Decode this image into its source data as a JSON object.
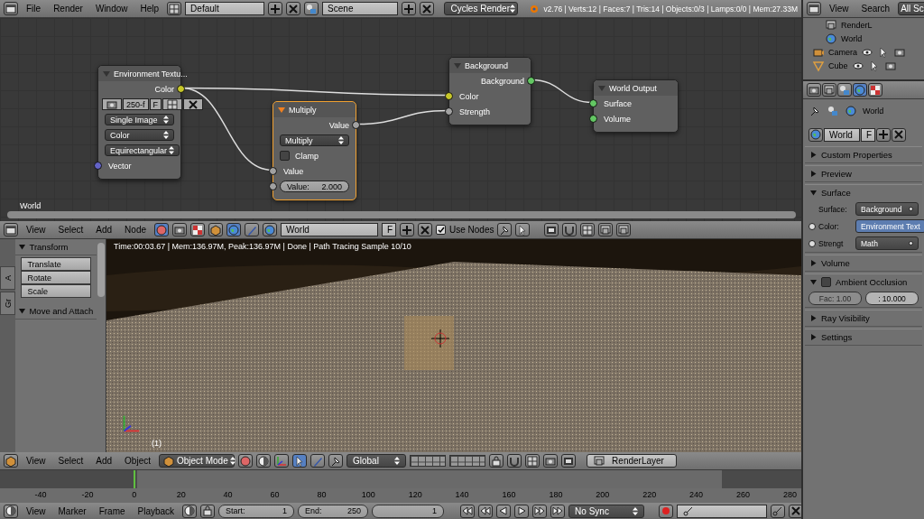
{
  "top_bar": {
    "menus": [
      "File",
      "Render",
      "Window",
      "Help"
    ],
    "layout": "Default",
    "scene": "Scene",
    "engine": "Cycles Render",
    "stats": "v2.76 | Verts:12 | Faces:7 | Tris:14 | Objects:0/3 | Lamps:0/0 | Mem:27.33M"
  },
  "node_editor": {
    "label": "World",
    "nodes": [
      {
        "title": "Environment Textu...",
        "selected": false,
        "rows": [
          {
            "kind": "output",
            "label": "Color",
            "color": "#c7c729"
          },
          {
            "kind": "image",
            "value": "250-f",
            "fake": "F"
          },
          {
            "kind": "dropdown",
            "value": "Single Image"
          },
          {
            "kind": "dropdown",
            "value": "Color"
          },
          {
            "kind": "dropdown",
            "value": "Equirectangular"
          },
          {
            "kind": "input",
            "label": "Vector",
            "color": "#6363c7"
          }
        ]
      },
      {
        "title": "Multiply",
        "selected": true,
        "rows": [
          {
            "kind": "output",
            "label": "Value",
            "color": "#a1a1a1"
          },
          {
            "kind": "dropdown",
            "value": "Multiply"
          },
          {
            "kind": "checkbox",
            "label": "Clamp",
            "checked": false
          },
          {
            "kind": "input",
            "label": "Value",
            "color": "#a1a1a1"
          },
          {
            "kind": "field",
            "label": "Value:",
            "value": "2.000",
            "color": "#a1a1a1"
          }
        ]
      },
      {
        "title": "Background",
        "selected": false,
        "rows": [
          {
            "kind": "output",
            "label": "Background",
            "color": "#63c763"
          },
          {
            "kind": "input",
            "label": "Color",
            "color": "#c7c729"
          },
          {
            "kind": "input",
            "label": "Strength",
            "color": "#a1a1a1"
          }
        ]
      },
      {
        "title": "World Output",
        "selected": false,
        "rows": [
          {
            "kind": "input",
            "label": "Surface",
            "color": "#63c763"
          },
          {
            "kind": "input",
            "label": "Volume",
            "color": "#63c763"
          }
        ]
      }
    ]
  },
  "node_header": {
    "menus": [
      "View",
      "Select",
      "Add",
      "Node"
    ],
    "world": "World",
    "fake": "F",
    "use_nodes": {
      "label": "Use Nodes",
      "checked": true
    }
  },
  "tool_shelf": {
    "tabs": [
      "A",
      "Gr"
    ],
    "panels": [
      {
        "title": "Transform",
        "expanded": true,
        "buttons": [
          "Translate",
          "Rotate",
          "Scale"
        ]
      },
      {
        "title": "Move and Attach",
        "expanded": true
      }
    ]
  },
  "viewport": {
    "render_info": "Time:00:03.67 | Mem:136.97M, Peak:136.97M | Done | Path Tracing Sample 10/10",
    "frame": "(1)"
  },
  "view3d_header": {
    "menus": [
      "View",
      "Select",
      "Add",
      "Object"
    ],
    "mode": "Object Mode",
    "orientation": "Global",
    "render_layer": "RenderLayer"
  },
  "timeline": {
    "ticks": [
      "-40",
      "-20",
      "0",
      "20",
      "40",
      "60",
      "80",
      "100",
      "120",
      "140",
      "160",
      "180",
      "200",
      "220",
      "240",
      "260",
      "280"
    ],
    "menus": [
      "View",
      "Marker",
      "Frame",
      "Playback"
    ],
    "start": {
      "label": "Start:",
      "value": "1"
    },
    "end": {
      "label": "End:",
      "value": "250"
    },
    "current": "1",
    "sync": "No Sync"
  },
  "outliner": {
    "menus": [
      "View",
      "Search"
    ],
    "filter": "All Sc",
    "items": [
      {
        "label": "RenderL",
        "kind": "layers"
      },
      {
        "label": "World",
        "kind": "world"
      },
      {
        "label": "Camera",
        "kind": "camera"
      },
      {
        "label": "Cube",
        "kind": "mesh"
      }
    ]
  },
  "properties": {
    "tabs": [
      {
        "kind": "render",
        "selected": false
      },
      {
        "kind": "layers",
        "selected": false
      },
      {
        "kind": "scene",
        "selected": false
      },
      {
        "kind": "world",
        "selected": true
      },
      {
        "kind": "texture",
        "selected": false
      }
    ],
    "breadcrumb": "World",
    "datablock": "World",
    "fake": "F",
    "panels": [
      {
        "title": "Custom Properties",
        "expanded": false
      },
      {
        "title": "Preview",
        "expanded": false
      },
      {
        "title": "Surface",
        "expanded": true,
        "fields": [
          {
            "label": "Surface:",
            "value": "Background",
            "linked": false,
            "socket": false
          },
          {
            "label": "Color:",
            "value": "Environment Text",
            "linked": true,
            "socket": true
          },
          {
            "label": "Strengt",
            "value": "Math",
            "linked": false,
            "socket": true
          }
        ]
      },
      {
        "title": "Volume",
        "expanded": false
      },
      {
        "title": "Ambient Occlusion",
        "expanded": true,
        "checkbox": false,
        "fac": "Fac: 1.00",
        "distance": ": 10.000"
      },
      {
        "title": "Ray Visibility",
        "expanded": false
      },
      {
        "title": "Settings",
        "expanded": false
      }
    ]
  }
}
